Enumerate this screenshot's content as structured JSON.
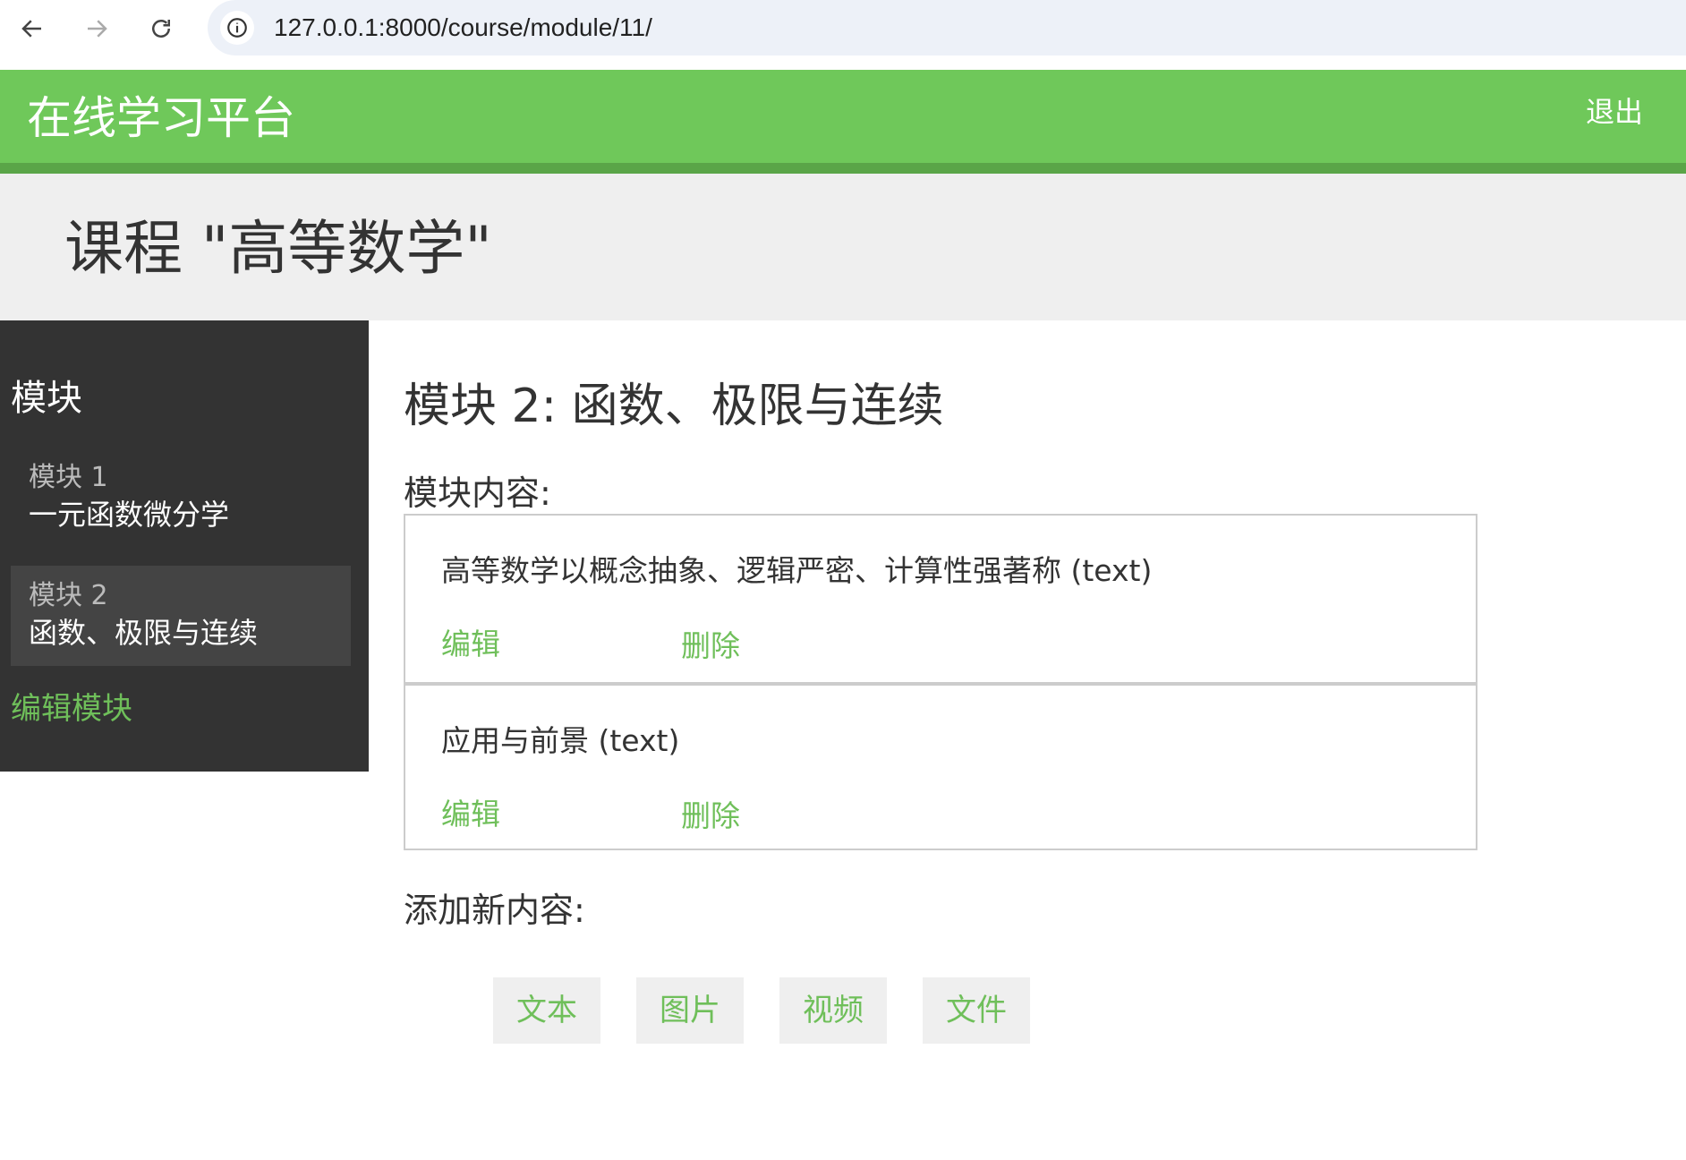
{
  "browser": {
    "url": "127.0.0.1:8000/course/module/11/"
  },
  "header": {
    "brand": "在线学习平台",
    "logout_label": "退出"
  },
  "course": {
    "title": "课程 \"高等数学\""
  },
  "sidebar": {
    "heading": "模块",
    "modules": [
      {
        "number": "模块 1",
        "name": "一元函数微分学",
        "active": false
      },
      {
        "number": "模块 2",
        "name": "函数、极限与连续",
        "active": true
      }
    ],
    "edit_link": "编辑模块"
  },
  "main": {
    "module_title": "模块 2: 函数、极限与连续",
    "content_label": "模块内容:",
    "contents": [
      {
        "text": "高等数学以概念抽象、逻辑严密、计算性强著称 (text)",
        "edit_label": "编辑",
        "delete_label": "删除"
      },
      {
        "text": "应用与前景 (text)",
        "edit_label": "编辑",
        "delete_label": "删除"
      }
    ],
    "add_label": "添加新内容:",
    "add_buttons": [
      "文本",
      "图片",
      "视频",
      "文件"
    ]
  },
  "colors": {
    "header_green": "#6fc85a",
    "link_green": "#6fbf5a",
    "sidebar_dark": "#333333"
  }
}
